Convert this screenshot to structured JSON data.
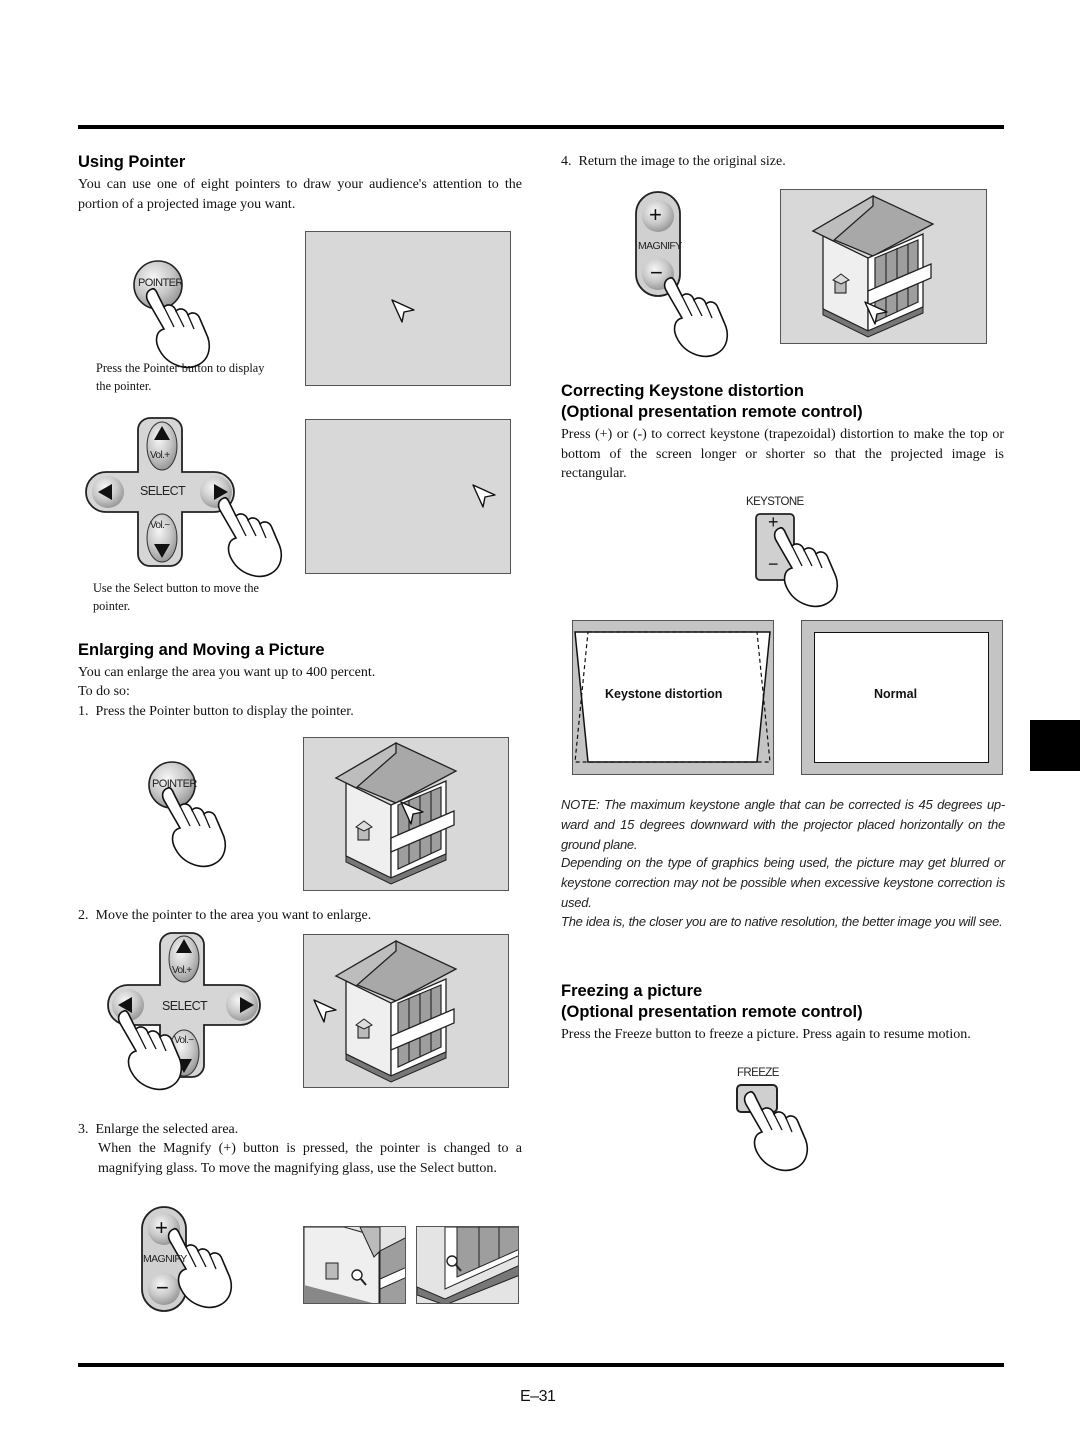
{
  "page": {
    "number": "E–31"
  },
  "left": {
    "using_pointer": {
      "title": "Using Pointer",
      "body": "You can use one of eight pointers to draw your audience's attention to the portion of a projected image you want.",
      "caption1": "Press the Pointer button to display the pointer.",
      "caption2": "Use the Select button to move the pointer."
    },
    "enlarging": {
      "title": "Enlarging and Moving a Picture",
      "intro": "You can enlarge the area you want up to 400 percent.",
      "todo": "To do so:",
      "step1": "1.  Press the Pointer button to display the pointer.",
      "step2": "2.  Move the pointer to the area you want to enlarge.",
      "step3": "3.  Enlarge the selected area.",
      "step3_detail": "When the Magnify (+) button is pressed, the pointer is changed to a magnifying glass. To move the magnifying glass, use the Select button."
    }
  },
  "right": {
    "step4": "4.  Return the image to the original size.",
    "keystone": {
      "title1": "Correcting Keystone distortion",
      "title2": "(Optional presentation remote control)",
      "body": "Press (+) or (-) to correct keystone (trapezoidal) distortion to make the top or bottom of the screen longer or shorter so that the projected image is rectangular.",
      "label_distortion": "Keystone distortion",
      "label_normal": "Normal",
      "note1": "NOTE: The maximum keystone angle that can be corrected is 45 degrees up-ward and 15 degrees downward with the projector placed horizontally on the ground plane.",
      "note2": "Depending on the type of graphics being used, the picture may get blurred or keystone correction may not be possible when excessive keystone correction is used.",
      "note3": "The idea is, the closer you are to native resolution, the better image you will see."
    },
    "freeze": {
      "title1": "Freezing a picture",
      "title2": "(Optional presentation remote control)",
      "body": "Press the Freeze button to freeze a picture. Press again to resume motion."
    }
  },
  "buttons": {
    "pointer": "POINTER",
    "select": "SELECT",
    "vol_plus": "Vol.+",
    "vol_minus": "Vol.−",
    "magnify": "MAGNIFY",
    "plus": "+",
    "minus": "−",
    "keystone": "KEYSTONE",
    "freeze": "FREEZE"
  }
}
